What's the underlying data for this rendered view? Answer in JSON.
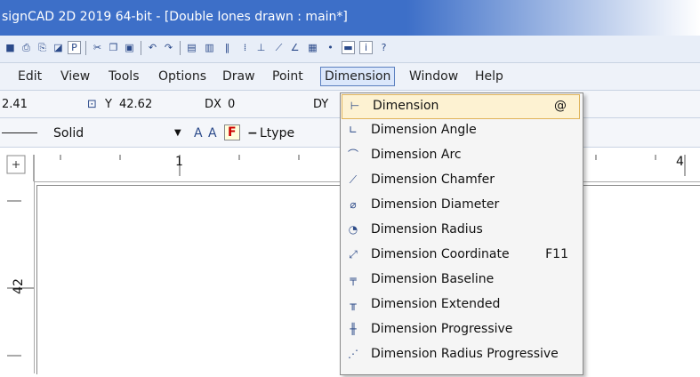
{
  "window": {
    "title": "signCAD 2D 2019 64-bit - [Double Iones drawn : main*]"
  },
  "toolbar": {
    "icons": [
      "save-icon",
      "print-icon",
      "print-preview-icon",
      "preview-icon",
      "print-setup-icon",
      "cut-icon",
      "copy-icon",
      "paste-icon",
      "undo-icon",
      "redo-icon",
      "open-icon",
      "new-icon",
      "pause-icon",
      "grid-icon",
      "snap-icon",
      "line-icon",
      "angle-icon",
      "layers-icon",
      "point-icon",
      "window-icon",
      "info-icon",
      "help-icon"
    ]
  },
  "menubar": {
    "items": [
      "Edit",
      "View",
      "Tools",
      "Options",
      "Draw",
      "Point",
      "Dimension",
      "Window",
      "Help"
    ]
  },
  "coords": {
    "x_value": "2.41",
    "y_label": "Y",
    "y_value": "42.62",
    "dx_label": "DX",
    "dx_value": "0",
    "dy_label": "DY"
  },
  "linebar": {
    "style": "Solid",
    "ltype": "Ltype"
  },
  "ruler": {
    "top_labels": [
      "1",
      "4"
    ],
    "left_label": "42"
  },
  "dropdown": {
    "items": [
      {
        "icon": "dimension-icon",
        "label": "Dimension",
        "shortcut": "@",
        "selected": true
      },
      {
        "icon": "dimension-angle-icon",
        "label": "Dimension Angle",
        "shortcut": ""
      },
      {
        "icon": "dimension-arc-icon",
        "label": "Dimension Arc",
        "shortcut": ""
      },
      {
        "icon": "dimension-chamfer-icon",
        "label": "Dimension Chamfer",
        "shortcut": ""
      },
      {
        "icon": "dimension-diameter-icon",
        "label": "Dimension Diameter",
        "shortcut": ""
      },
      {
        "icon": "dimension-radius-icon",
        "label": "Dimension Radius",
        "shortcut": ""
      },
      {
        "icon": "dimension-coordinate-icon",
        "label": "Dimension Coordinate",
        "shortcut": "F11"
      },
      {
        "icon": "dimension-baseline-icon",
        "label": "Dimension Baseline",
        "shortcut": ""
      },
      {
        "icon": "dimension-extended-icon",
        "label": "Dimension Extended",
        "shortcut": ""
      },
      {
        "icon": "dimension-progressive-icon",
        "label": "Dimension Progressive",
        "shortcut": ""
      },
      {
        "icon": "dimension-radius-progressive-icon",
        "label": "Dimension Radius Progressive",
        "shortcut": ""
      }
    ]
  },
  "colors": {
    "titlebar": "#3d6fc8",
    "menu_highlight": "#fdf2d2",
    "menu_highlight_border": "#e0b45a"
  }
}
